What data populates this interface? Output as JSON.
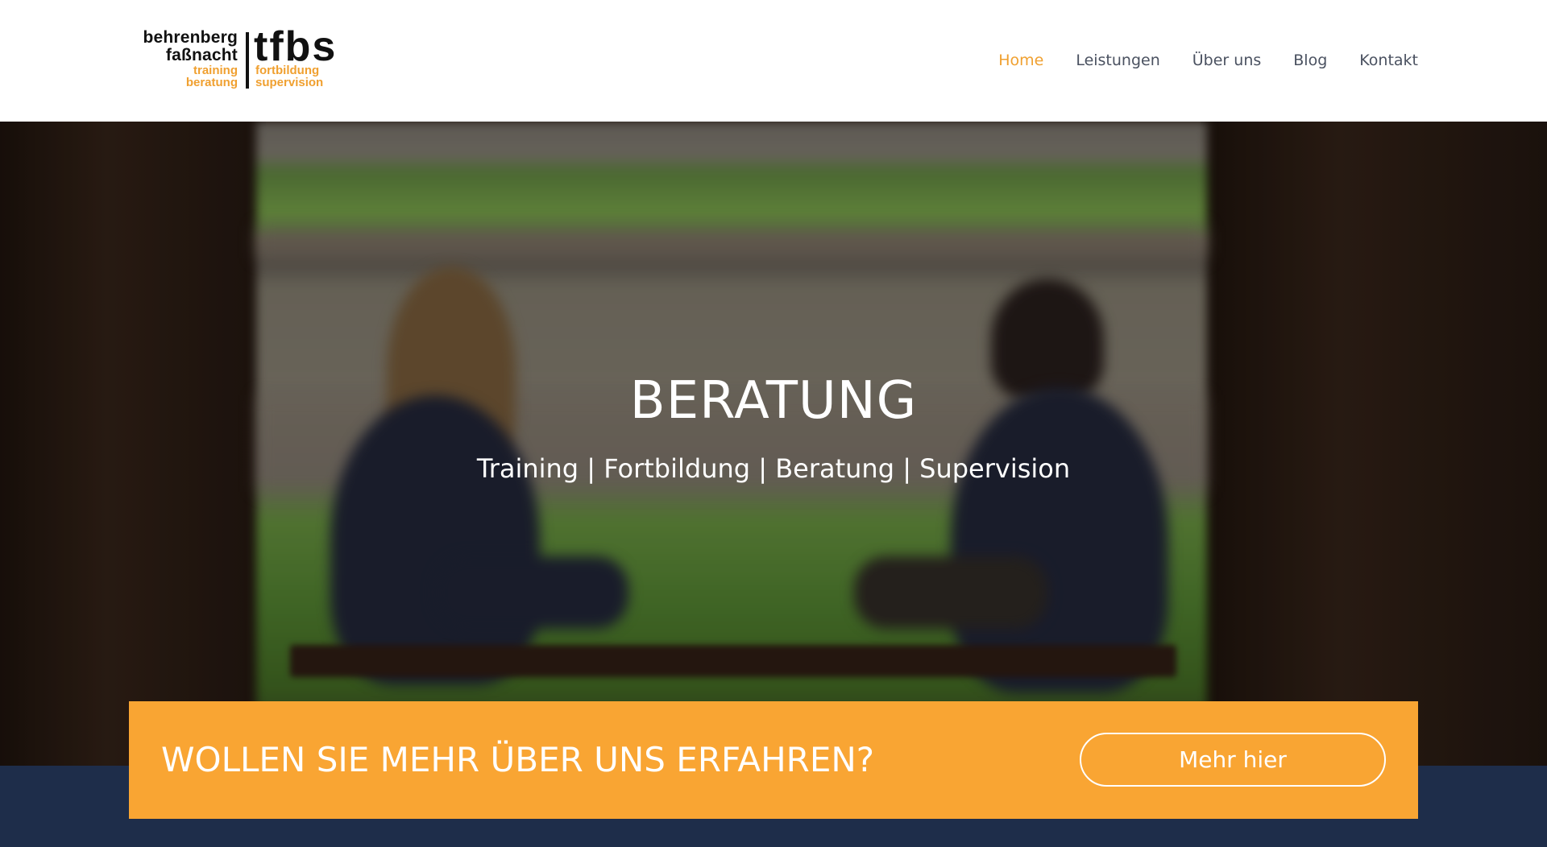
{
  "logo": {
    "name_line_1": "behrenberg",
    "name_line_2": "faßnacht",
    "sub_left_1": "training",
    "sub_left_2": "beratung",
    "mark": "tfbs",
    "sub_right_1": "fortbildung",
    "sub_right_2": "supervision"
  },
  "nav": {
    "items": [
      {
        "label": "Home",
        "active": true
      },
      {
        "label": "Leistungen",
        "active": false
      },
      {
        "label": "Über uns",
        "active": false
      },
      {
        "label": "Blog",
        "active": false
      },
      {
        "label": "Kontakt",
        "active": false
      }
    ]
  },
  "hero": {
    "title": "BERATUNG",
    "subtitle": "Training | Fortbildung | Beratung | Supervision"
  },
  "cta": {
    "text": "WOLLEN SIE MEHR ÜBER UNS ERFAHREN?",
    "button_label": "Mehr hier"
  },
  "colors": {
    "accent": "#f9a533",
    "nav_active": "#f0a030",
    "nav_text": "#4a5160",
    "navy": "#1e2d4a"
  }
}
